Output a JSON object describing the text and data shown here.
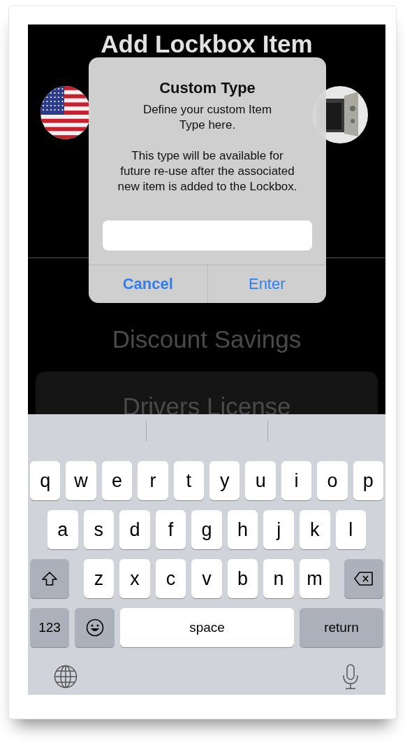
{
  "screen": {
    "title": "Add Lockbox Item",
    "list_items": [
      {
        "label": "Discount Savings",
        "kind": "plain"
      },
      {
        "label": "Drivers License",
        "kind": "card"
      }
    ]
  },
  "alert": {
    "title": "Custom Type",
    "message": "Define your custom Item Type here.",
    "detail": "This type will be available for future re-use after the associated new item is added to the Lockbox.",
    "buttons": [
      {
        "label": "Cancel",
        "bold": true
      },
      {
        "label": "Enter",
        "bold": false
      }
    ]
  },
  "keyboard": {
    "rows": [
      {
        "keys": [
          {
            "kind": "letter",
            "label": "q"
          },
          {
            "kind": "letter",
            "label": "w"
          },
          {
            "kind": "letter",
            "label": "e"
          },
          {
            "kind": "letter",
            "label": "r"
          },
          {
            "kind": "letter",
            "label": "t"
          },
          {
            "kind": "letter",
            "label": "y"
          },
          {
            "kind": "letter",
            "label": "u"
          },
          {
            "kind": "letter",
            "label": "i"
          },
          {
            "kind": "letter",
            "label": "o"
          },
          {
            "kind": "letter",
            "label": "p"
          }
        ]
      },
      {
        "keys": [
          {
            "kind": "letter",
            "label": "a"
          },
          {
            "kind": "letter",
            "label": "s"
          },
          {
            "kind": "letter",
            "label": "d"
          },
          {
            "kind": "letter",
            "label": "f"
          },
          {
            "kind": "letter",
            "label": "g"
          },
          {
            "kind": "letter",
            "label": "h"
          },
          {
            "kind": "letter",
            "label": "j"
          },
          {
            "kind": "letter",
            "label": "k"
          },
          {
            "kind": "letter",
            "label": "l"
          }
        ]
      },
      {
        "keys": [
          {
            "kind": "shift"
          },
          {
            "kind": "letter",
            "label": "z"
          },
          {
            "kind": "letter",
            "label": "x"
          },
          {
            "kind": "letter",
            "label": "c"
          },
          {
            "kind": "letter",
            "label": "v"
          },
          {
            "kind": "letter",
            "label": "b"
          },
          {
            "kind": "letter",
            "label": "n"
          },
          {
            "kind": "letter",
            "label": "m"
          },
          {
            "kind": "delete"
          }
        ]
      },
      {
        "keys": [
          {
            "kind": "numbers",
            "label": "123"
          },
          {
            "kind": "emoji"
          },
          {
            "kind": "space",
            "label": "space"
          },
          {
            "kind": "return",
            "label": "return"
          }
        ]
      }
    ]
  }
}
